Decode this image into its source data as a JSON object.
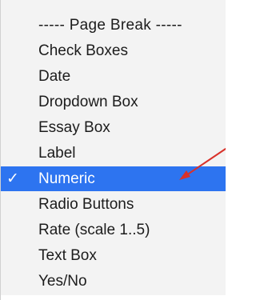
{
  "menu": {
    "items": [
      {
        "label": "----- Page Break -----",
        "checked": false,
        "selected": false
      },
      {
        "label": "Check Boxes",
        "checked": false,
        "selected": false
      },
      {
        "label": "Date",
        "checked": false,
        "selected": false
      },
      {
        "label": "Dropdown Box",
        "checked": false,
        "selected": false
      },
      {
        "label": "Essay Box",
        "checked": false,
        "selected": false
      },
      {
        "label": "Label",
        "checked": false,
        "selected": false
      },
      {
        "label": "Numeric",
        "checked": true,
        "selected": true
      },
      {
        "label": "Radio Buttons",
        "checked": false,
        "selected": false
      },
      {
        "label": "Rate (scale 1..5)",
        "checked": false,
        "selected": false
      },
      {
        "label": "Text Box",
        "checked": false,
        "selected": false
      },
      {
        "label": "Yes/No",
        "checked": false,
        "selected": false
      }
    ],
    "check_glyph": "✓"
  },
  "colors": {
    "menu_background": "#f3f3f3",
    "selection": "#2d74f0",
    "arrow": "#d9312a"
  }
}
